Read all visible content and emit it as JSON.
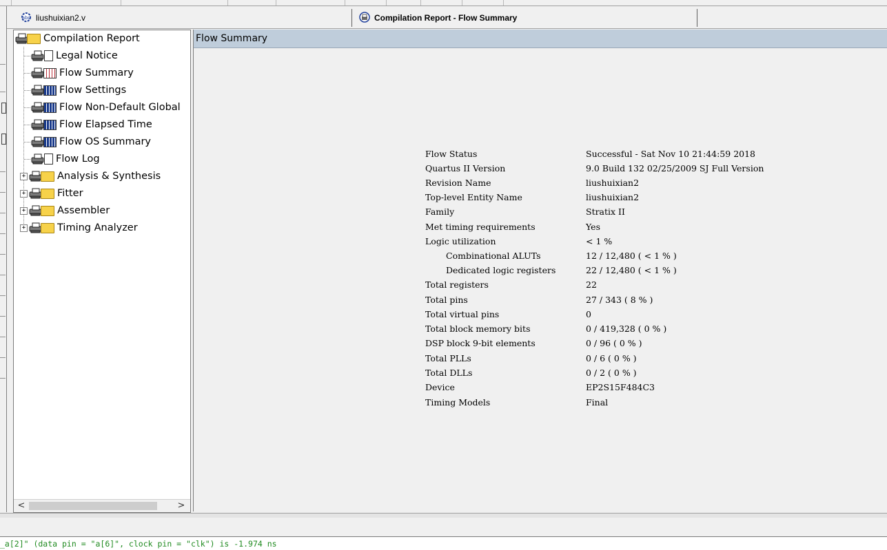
{
  "tabs": {
    "file_tab": "liushuixian2.v",
    "report_tab": "Compilation Report - Flow Summary"
  },
  "tree": {
    "root": "Compilation Report",
    "children": [
      {
        "label": "Legal Notice",
        "icon": "document-icon"
      },
      {
        "label": "Flow Summary",
        "icon": "table-icon"
      },
      {
        "label": "Flow Settings",
        "icon": "table-icon"
      },
      {
        "label": "Flow Non-Default Global",
        "icon": "table-icon"
      },
      {
        "label": "Flow Elapsed Time",
        "icon": "table-icon"
      },
      {
        "label": "Flow OS Summary",
        "icon": "table-icon"
      },
      {
        "label": "Flow Log",
        "icon": "document-icon"
      }
    ],
    "folders": [
      {
        "label": "Analysis & Synthesis",
        "expander": "+"
      },
      {
        "label": "Fitter",
        "expander": "+"
      },
      {
        "label": "Assembler",
        "expander": "+"
      },
      {
        "label": "Timing Analyzer",
        "expander": "+"
      }
    ],
    "scroll_left": "<",
    "scroll_right": ">"
  },
  "report": {
    "header": "Flow Summary",
    "rows": [
      {
        "key": "Flow Status",
        "value": "Successful - Sat Nov 10 21:44:59 2018"
      },
      {
        "key": "Quartus II Version",
        "value": "9.0 Build 132 02/25/2009 SJ Full Version"
      },
      {
        "key": "Revision Name",
        "value": "liushuixian2"
      },
      {
        "key": "Top-level Entity Name",
        "value": "liushuixian2"
      },
      {
        "key": "Family",
        "value": "Stratix II"
      },
      {
        "key": "Met timing requirements",
        "value": "Yes"
      },
      {
        "key": "Logic utilization",
        "value": "< 1 %"
      },
      {
        "key": "Combinational ALUTs",
        "value": "12 / 12,480 ( < 1 % )"
      },
      {
        "key": "Dedicated logic registers",
        "value": "22 / 12,480 ( < 1 % )"
      },
      {
        "key": "Total registers",
        "value": "22"
      },
      {
        "key": "Total pins",
        "value": "27 / 343 ( 8 % )"
      },
      {
        "key": "Total virtual pins",
        "value": "0"
      },
      {
        "key": "Total block memory bits",
        "value": "0 / 419,328 ( 0 % )"
      },
      {
        "key": "DSP block 9-bit elements",
        "value": "0 / 96 ( 0 % )"
      },
      {
        "key": "Total PLLs",
        "value": "0 / 6 ( 0 % )"
      },
      {
        "key": "Total DLLs",
        "value": "0 / 2 ( 0 % )"
      },
      {
        "key": "Device",
        "value": "EP2S15F484C3"
      },
      {
        "key": "Timing Models",
        "value": "Final"
      }
    ]
  },
  "messages": {
    "line": "_a[2]\" (data pin = \"a[6]\", clock pin = \"clk\") is -1.974 ns"
  },
  "colors": {
    "report_header_bg": "#bfcddb",
    "message_text": "#1f8a1f"
  }
}
